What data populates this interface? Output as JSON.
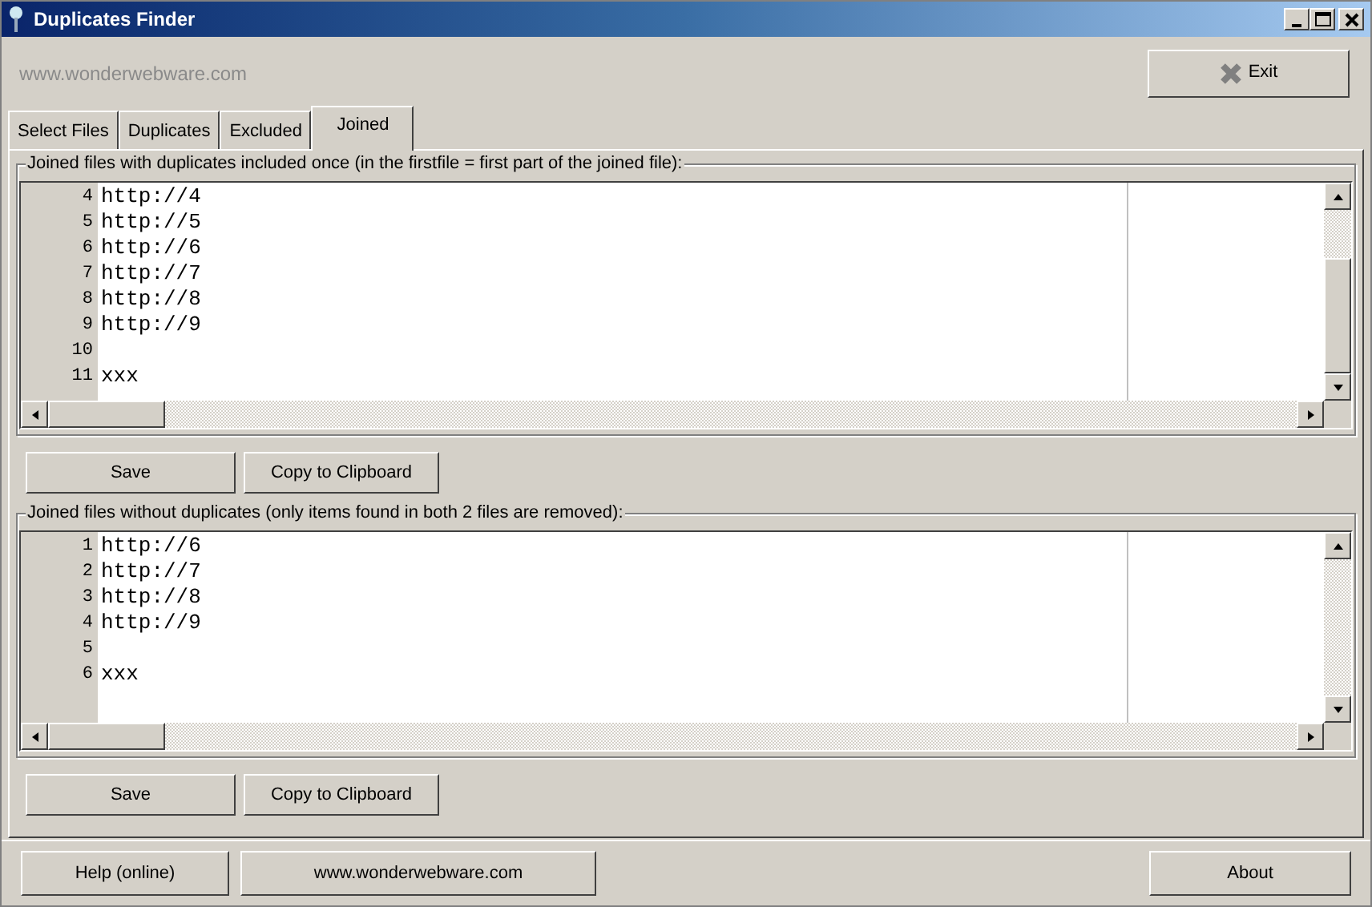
{
  "window": {
    "title": "Duplicates Finder"
  },
  "website_label": "www.wonderwebware.com",
  "exit_button": "Exit",
  "tabs": [
    {
      "label": "Select Files",
      "selected": false
    },
    {
      "label": "Duplicates",
      "selected": false
    },
    {
      "label": "Excluded",
      "selected": false
    },
    {
      "label": "Joined",
      "selected": true
    }
  ],
  "panels": [
    {
      "label": "Joined files with duplicates included once (in the firstfile = first part of the joined file):",
      "lines": [
        {
          "number": "4",
          "text": "http://4"
        },
        {
          "number": "5",
          "text": "http://5"
        },
        {
          "number": "6",
          "text": "http://6"
        },
        {
          "number": "7",
          "text": "http://7"
        },
        {
          "number": "8",
          "text": "http://8"
        },
        {
          "number": "9",
          "text": "http://9"
        },
        {
          "number": "10"
        },
        {
          "number": "11",
          "text": "xxx"
        }
      ],
      "buttons": [
        "Save",
        "Copy to Clipboard"
      ]
    },
    {
      "label": "Joined files without duplicates (only items found in both 2 files are removed):",
      "lines": [
        {
          "number": "1",
          "text": "http://6"
        },
        {
          "number": "2",
          "text": "http://7"
        },
        {
          "number": "3",
          "text": "http://8"
        },
        {
          "number": "4",
          "text": "http://9"
        },
        {
          "number": "5"
        },
        {
          "number": "6",
          "text": "xxx"
        }
      ],
      "buttons": [
        "Save",
        "Copy to Clipboard"
      ]
    }
  ],
  "bottom_buttons": [
    "Help (online)",
    "www.wonderwebware.com",
    "About"
  ]
}
